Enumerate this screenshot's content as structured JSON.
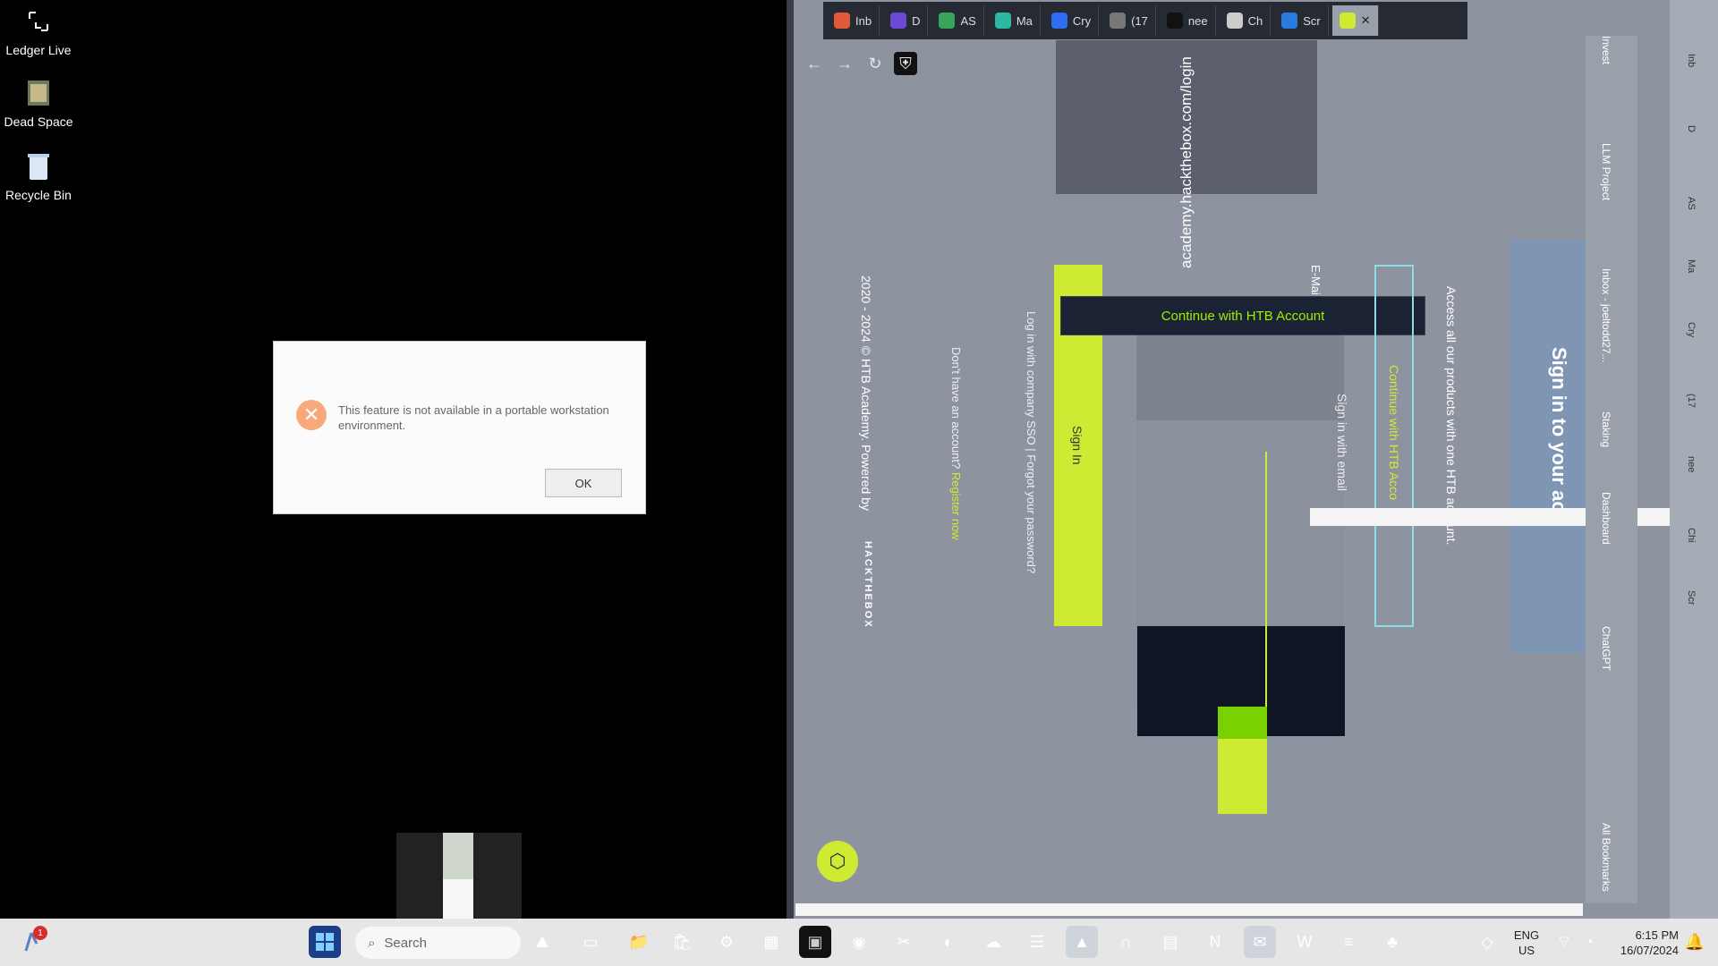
{
  "desktop": {
    "icons": [
      {
        "label": "Ledger Live"
      },
      {
        "label": "Dead Space"
      },
      {
        "label": "Recycle Bin"
      }
    ]
  },
  "dialog": {
    "message": "This feature is not available in a portable workstation environment.",
    "ok_label": "OK",
    "icon": "error-icon"
  },
  "browser": {
    "tabs": [
      {
        "label": "Inb",
        "color": "#e05a3a"
      },
      {
        "label": "D",
        "color": "#6b4bd6"
      },
      {
        "label": "AS",
        "color": "#3aa35a"
      },
      {
        "label": "Ma",
        "color": "#2bb7a2"
      },
      {
        "label": "Cry",
        "color": "#2d6df0"
      },
      {
        "label": "(17",
        "color": "#777777"
      },
      {
        "label": "nee",
        "color": "#111111"
      },
      {
        "label": "Ch",
        "color": "#cccccc"
      },
      {
        "label": "Scr",
        "color": "#2a7be0"
      }
    ],
    "url": "academy.hackthebox.com/login",
    "page": {
      "cta": "Continue with HTB Account",
      "cta2": "Continue with HTB Acco",
      "sign_in_email": "Sign in with email",
      "access_text": "Access all our products with one HTB account.",
      "sso_text": "Log in with company SSO | Forgot your password?",
      "register_prefix": "Don't have an account?",
      "register_link": "Register now",
      "footer": "2020 - 2024 © HTB Academy. Powered by",
      "brand": "HACKTHEBOX",
      "sign_in_heading": "Sign in to your acc",
      "sign_in_btn": "Sign In",
      "email_label": "E-Mai"
    },
    "sidepanel": {
      "items": [
        "Invest",
        "LLM Project",
        "Inbox - joeltodd27...",
        "Staking",
        "Dashboard",
        "ChatGPT",
        "All Bookmarks"
      ]
    },
    "rightbar": {
      "items": [
        "Inb",
        "D",
        "AS",
        "Ma",
        "Cry",
        "(17",
        "nee",
        "Chi",
        "Scr"
      ]
    }
  },
  "taskbar": {
    "search_placeholder": "Search",
    "notification_count": "1",
    "language": "ENG",
    "region": "US",
    "time": "6:15 PM",
    "date": "16/07/2024"
  }
}
